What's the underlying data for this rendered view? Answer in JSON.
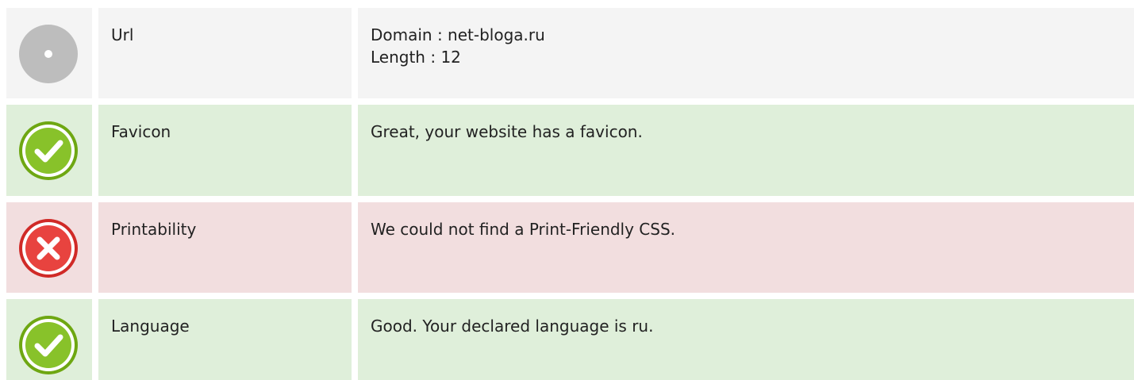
{
  "rows": [
    {
      "label": "Url",
      "status": "neutral",
      "icon": "info-icon",
      "lines": [
        "Domain : net-bloga.ru",
        "Length : 12"
      ]
    },
    {
      "label": "Favicon",
      "status": "pass",
      "icon": "check-icon",
      "lines": [
        "Great, your website has a favicon."
      ]
    },
    {
      "label": "Printability",
      "status": "fail",
      "icon": "cross-icon",
      "lines": [
        "We could not find a Print-Friendly CSS."
      ]
    },
    {
      "label": "Language",
      "status": "pass",
      "icon": "check-icon",
      "lines": [
        "Good. Your declared language is ru."
      ]
    }
  ],
  "colors": {
    "neutral_bg": "#f4f4f4",
    "pass_bg": "#dfefda",
    "fail_bg": "#f2dedf",
    "pass_icon": "#7ab51d",
    "fail_icon": "#e0332f",
    "neutral_icon": "#bdbdbd"
  }
}
